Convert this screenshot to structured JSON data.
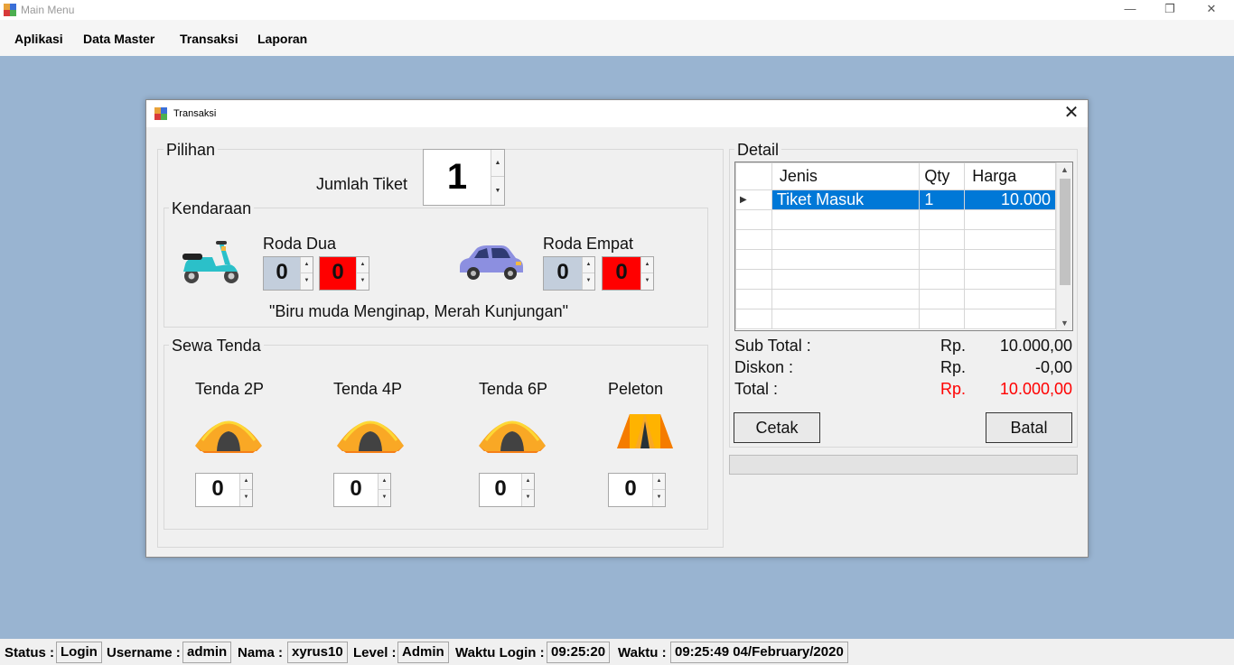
{
  "window": {
    "title": "Main Menu",
    "minimize": "—",
    "restore": "❐",
    "close": "✕"
  },
  "menu": {
    "items": [
      "Aplikasi",
      "Data Master",
      "Transaksi",
      "Laporan"
    ]
  },
  "dialog": {
    "title": "Transaksi",
    "close": "✕"
  },
  "pilihan": {
    "group_label": "Pilihan",
    "jumlah_tiket_label": "Jumlah Tiket",
    "jumlah_tiket_value": "1"
  },
  "kendaraan": {
    "group_label": "Kendaraan",
    "roda_dua_label": "Roda Dua",
    "roda_dua_inap": "0",
    "roda_dua_kunjungan": "0",
    "roda_empat_label": "Roda Empat",
    "roda_empat_inap": "0",
    "roda_empat_kunjungan": "0",
    "note": "\"Biru muda Menginap, Merah Kunjungan\"",
    "inap_color": "#c3cedc",
    "kunjungan_color": "#ff0000"
  },
  "sewa_tenda": {
    "group_label": "Sewa Tenda",
    "items": [
      {
        "label": "Tenda 2P",
        "value": "0",
        "icon": "dome-tent-icon"
      },
      {
        "label": "Tenda 4P",
        "value": "0",
        "icon": "dome-tent-icon"
      },
      {
        "label": "Tenda 6P",
        "value": "0",
        "icon": "dome-tent-icon"
      },
      {
        "label": "Peleton",
        "value": "0",
        "icon": "peleton-tent-icon"
      }
    ]
  },
  "detail": {
    "group_label": "Detail",
    "columns": [
      "Jenis",
      "Qty",
      "Harga"
    ],
    "rows": [
      {
        "jenis": "Tiket Masuk",
        "qty": "1",
        "harga": "10.000"
      }
    ],
    "empty_rows": 6,
    "sub_total_label": "Sub Total :",
    "sub_total_currency": "Rp.",
    "sub_total_value": "10.000,00",
    "diskon_label": "Diskon :",
    "diskon_currency": "Rp.",
    "diskon_value": "-0,00",
    "total_label": "Total :",
    "total_currency": "Rp.",
    "total_value": "10.000,00",
    "total_color": "#ff0000",
    "cetak_button": "Cetak",
    "batal_button": "Batal"
  },
  "status": {
    "status_label": "Status :",
    "status_value": "Login",
    "username_label": "Username :",
    "username_value": "admin",
    "nama_label": "Nama :",
    "nama_value": "xyrus10",
    "level_label": "Level :",
    "level_value": "Admin",
    "waktu_login_label": "Waktu Login :",
    "waktu_login_value": "09:25:20",
    "waktu_label": "Waktu :",
    "waktu_value": "09:25:49 04/February/2020"
  }
}
